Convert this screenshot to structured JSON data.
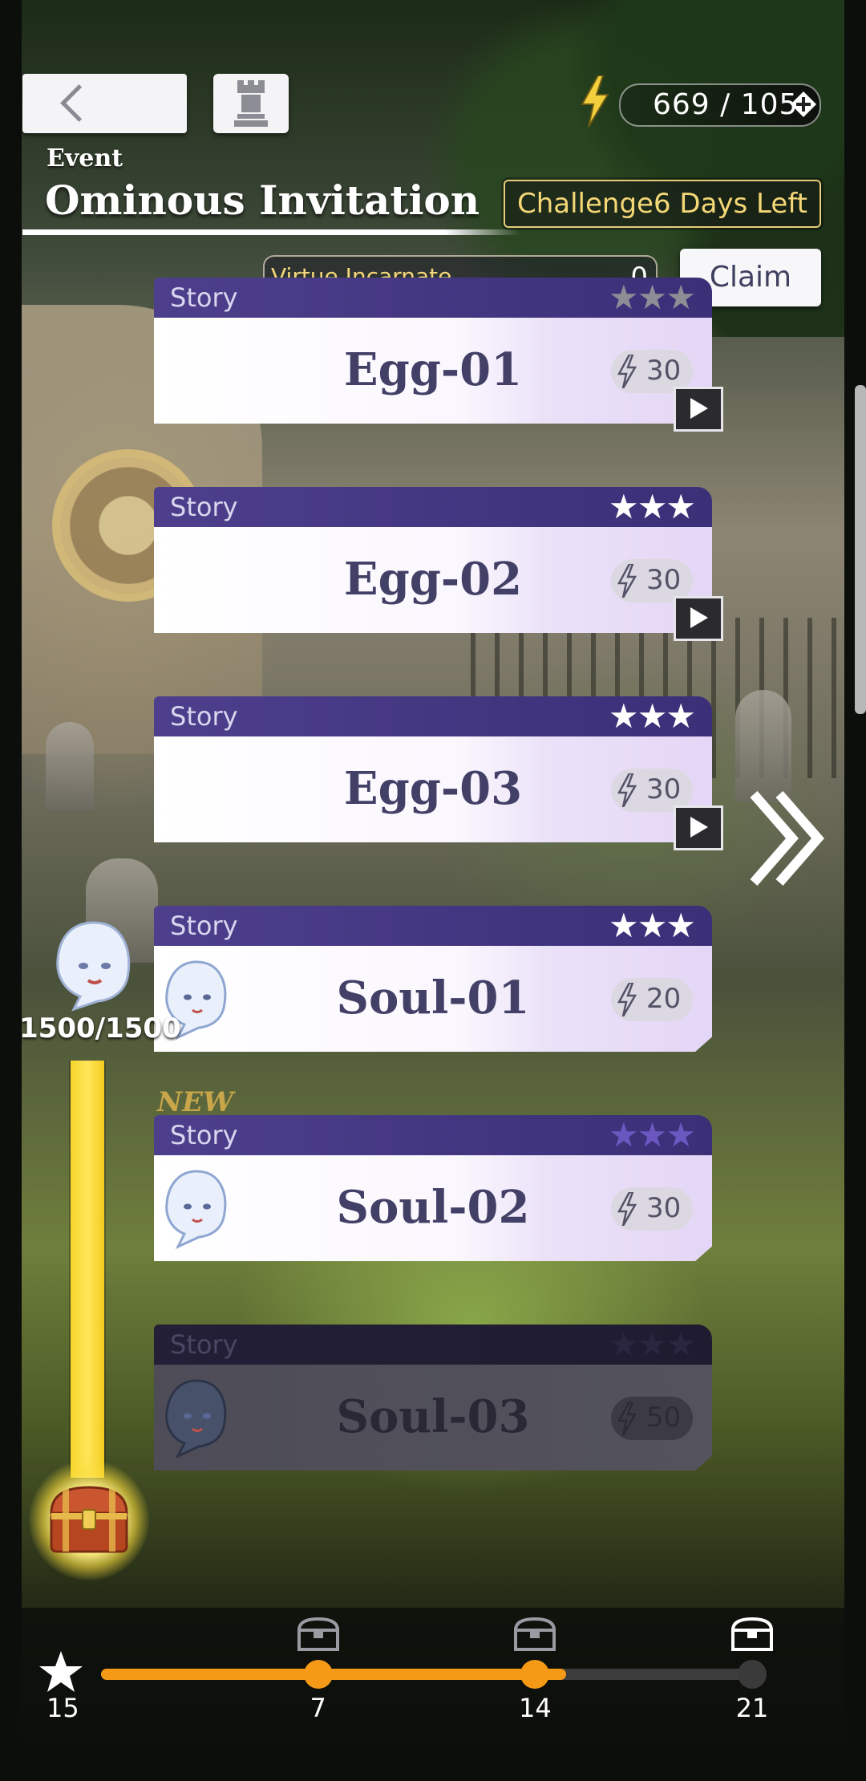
{
  "header": {
    "event_label": "Event",
    "event_title": "Ominous Invitation",
    "challenge": "Challenge6 Days Left",
    "energy": "669 / 105"
  },
  "virtue": {
    "name": "Virtue Incarnate",
    "value": "0",
    "claim_label": "Claim"
  },
  "stages": [
    {
      "type": "Story",
      "name": "Egg-01",
      "cost": "30",
      "stars": 3,
      "stars_earned": 0,
      "has_play": true,
      "has_ghost": false,
      "locked": false
    },
    {
      "type": "Story",
      "name": "Egg-02",
      "cost": "30",
      "stars": 3,
      "stars_earned": 3,
      "has_play": true,
      "has_ghost": false,
      "locked": false
    },
    {
      "type": "Story",
      "name": "Egg-03",
      "cost": "30",
      "stars": 3,
      "stars_earned": 3,
      "has_play": true,
      "has_ghost": false,
      "locked": false
    },
    {
      "type": "Story",
      "name": "Soul-01",
      "cost": "20",
      "stars": 3,
      "stars_earned": 3,
      "has_play": false,
      "has_ghost": true,
      "locked": false
    },
    {
      "type": "Story",
      "name": "Soul-02",
      "cost": "30",
      "stars": 3,
      "stars_earned": 0,
      "has_play": false,
      "has_ghost": true,
      "locked": false,
      "tag": "NEW"
    },
    {
      "type": "Story",
      "name": "Soul-03",
      "cost": "50",
      "stars": 3,
      "stars_earned": 0,
      "has_play": false,
      "has_ghost": true,
      "locked": true
    }
  ],
  "left_progress": {
    "score": "1500/1500",
    "fill_fraction": 1.0
  },
  "star_progress": {
    "total": "15",
    "max": 21,
    "milestones": [
      {
        "value": "7",
        "reached": true
      },
      {
        "value": "14",
        "reached": true
      },
      {
        "value": "21",
        "reached": false
      }
    ],
    "fill_fraction": 0.714
  },
  "colors": {
    "accent_gold": "#f4d776",
    "stage_header": "#4d3f8c",
    "progress_orange": "#f49a16",
    "progress_yellow": "#f6d42a"
  },
  "icons": [
    "back-chevron-icon",
    "tower-icon",
    "lightning-icon",
    "plus-icon",
    "star-icon",
    "play-icon",
    "ghost-icon",
    "chest-icon",
    "double-chevron-right-icon"
  ]
}
